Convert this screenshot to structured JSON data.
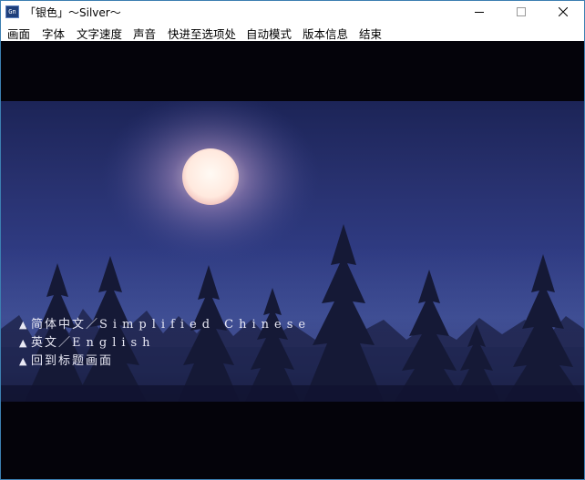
{
  "window": {
    "title": "「银色」～Silver～",
    "app_icon_text": "Gn",
    "controls": [
      "minimize-icon",
      "maximize-icon",
      "close-icon"
    ]
  },
  "menu": {
    "items": [
      "画面",
      "字体",
      "文字速度",
      "声音",
      "快进至选项处",
      "自动模式",
      "版本信息",
      "结束"
    ]
  },
  "game": {
    "scene": "night-sky-moon-pine-trees",
    "choice_marker": "▲",
    "choices": [
      {
        "label": "简体中文／",
        "latin": "Simplified Chinese"
      },
      {
        "label": "英文／",
        "latin": "English"
      },
      {
        "label": "回到标题画面",
        "latin": ""
      }
    ]
  },
  "colors": {
    "sky_top": "#1c2457",
    "sky_mid": "#2f3b82",
    "moon": "#fff4ee",
    "letterbox": "#04030a",
    "choice_text": "#e8e8f4",
    "window_border": "#3c7fb1"
  }
}
